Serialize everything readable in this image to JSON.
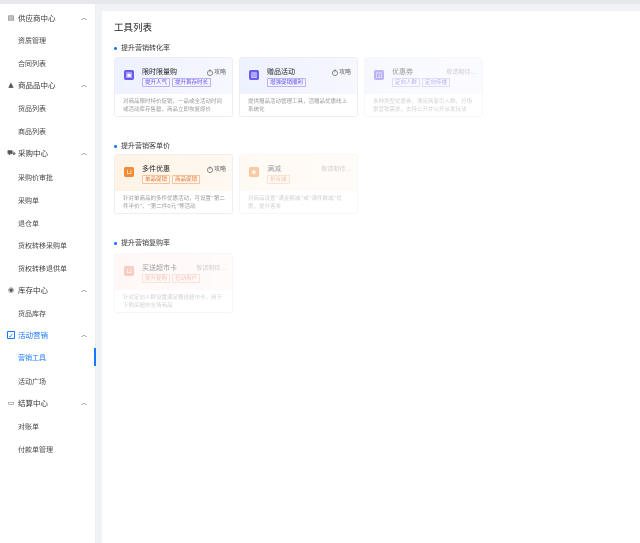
{
  "sidebar": {
    "groups": [
      {
        "label": "供应商中心",
        "icon": "supplier-icon",
        "items": [
          {
            "label": "资质管理"
          },
          {
            "label": "合同列表"
          }
        ]
      },
      {
        "label": "商品品中心",
        "icon": "product-icon",
        "items": [
          {
            "label": "货品列表"
          },
          {
            "label": "商品列表"
          }
        ]
      },
      {
        "label": "采购中心",
        "icon": "cart-icon",
        "items": [
          {
            "label": "采购价审批"
          },
          {
            "label": "采购单"
          },
          {
            "label": "退仓单"
          },
          {
            "label": "货权转移采购单"
          },
          {
            "label": "货权转移退供单"
          }
        ]
      },
      {
        "label": "库存中心",
        "icon": "inventory-icon",
        "items": [
          {
            "label": "货品库存"
          }
        ]
      },
      {
        "label": "活动营销",
        "icon": "marketing-icon",
        "items": [
          {
            "label": "营销工具"
          },
          {
            "label": "活动广场"
          }
        ]
      },
      {
        "label": "结算中心",
        "icon": "settlement-icon",
        "items": [
          {
            "label": "对账单"
          },
          {
            "label": "付款单管理"
          }
        ]
      }
    ]
  },
  "main": {
    "title": "工具列表",
    "sections": [
      {
        "title": "提升营销转化率",
        "cards": [
          {
            "name": "限时限量购",
            "guide": "攻略",
            "tags": [
              "提升人气",
              "提升首存时长"
            ],
            "desc": "对商品限时特价促销，一品或全活动时间或活动库存售罄，商品立即恢复原价"
          },
          {
            "name": "赠品活动",
            "guide": "攻略",
            "tags": [
              "增强促销顺利"
            ],
            "desc": "提供赠品活动管理工具，活赠品优惠线上系统化"
          },
          {
            "name": "优惠券",
            "wait": "敬请期待...",
            "tags": [
              "定向人群",
              "定向传播"
            ],
            "desc": "多种类型优惠券，满足商家引入群、分场景营销需求，支持公开并公开派发玩法"
          }
        ]
      },
      {
        "title": "提升营销客单价",
        "cards": [
          {
            "name": "多件优惠",
            "guide": "攻略",
            "tags": [
              "单品促销",
              "商品促销"
            ],
            "desc": "针对单商品的多件优惠活动，可设置“第二件半价”、“第二件0元”等活动"
          },
          {
            "name": "满减",
            "wait": "敬请期待...",
            "tags": [
              "折合减"
            ],
            "desc": "对商品设置“满金额减”或“满件数减”优惠，提升客单"
          }
        ]
      },
      {
        "title": "提升营销复购率",
        "cards": [
          {
            "name": "买送超市卡",
            "wait": "敬请期待...",
            "tags": [
              "提升复购",
              "拉动用户"
            ],
            "desc": "针对定向人群设置满足赠送超市卡，用于下购买超市全场商品"
          }
        ]
      }
    ]
  },
  "colors": {
    "accent": "#1677ff",
    "blue_card": "#6a5cf0",
    "orange_card": "#f08a34"
  }
}
